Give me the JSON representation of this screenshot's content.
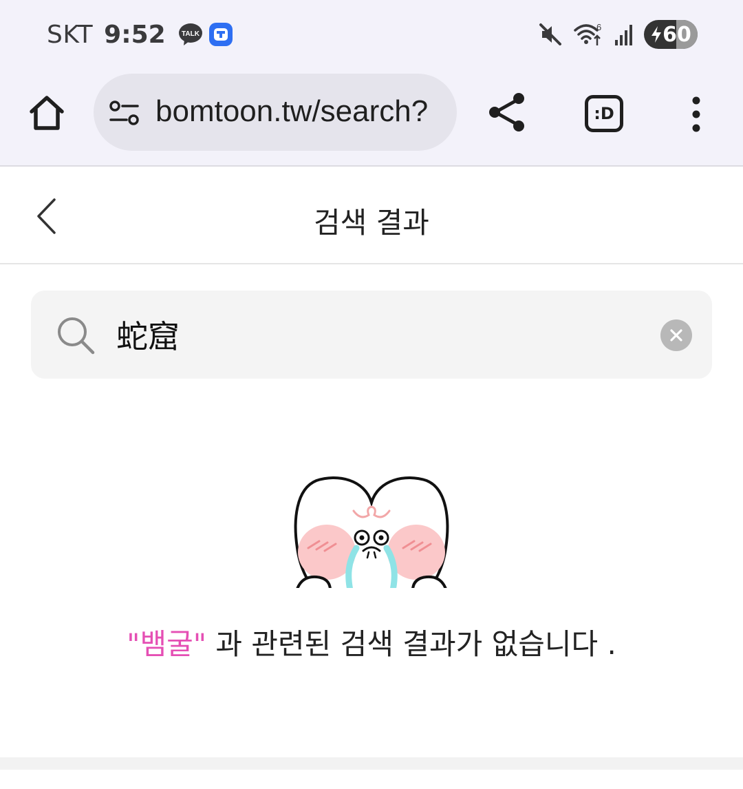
{
  "status_bar": {
    "carrier": "SKT",
    "time": "9:52",
    "talk_badge": "TALK",
    "battery_level": "60",
    "battery_charging": true
  },
  "browser": {
    "url": "bomtoon.tw/search?",
    "tab_button_label": ":D"
  },
  "page": {
    "title": "검색 결과"
  },
  "search": {
    "query": "蛇窟"
  },
  "empty_state": {
    "keyword": "\"뱀굴\"",
    "message": " 과 관련된 검색 결과가 없습니다 ."
  },
  "colors": {
    "chrome_bg": "#f3f2fa",
    "url_bar_bg": "#e5e4ec",
    "search_bg": "#f4f4f4",
    "keyword_accent": "#e54fb4"
  },
  "icons": {
    "home": "home-icon",
    "site_settings": "site-settings-icon",
    "share": "share-icon",
    "more": "more-vert-icon",
    "back": "chevron-left-icon",
    "search": "search-icon",
    "clear": "close-icon"
  }
}
